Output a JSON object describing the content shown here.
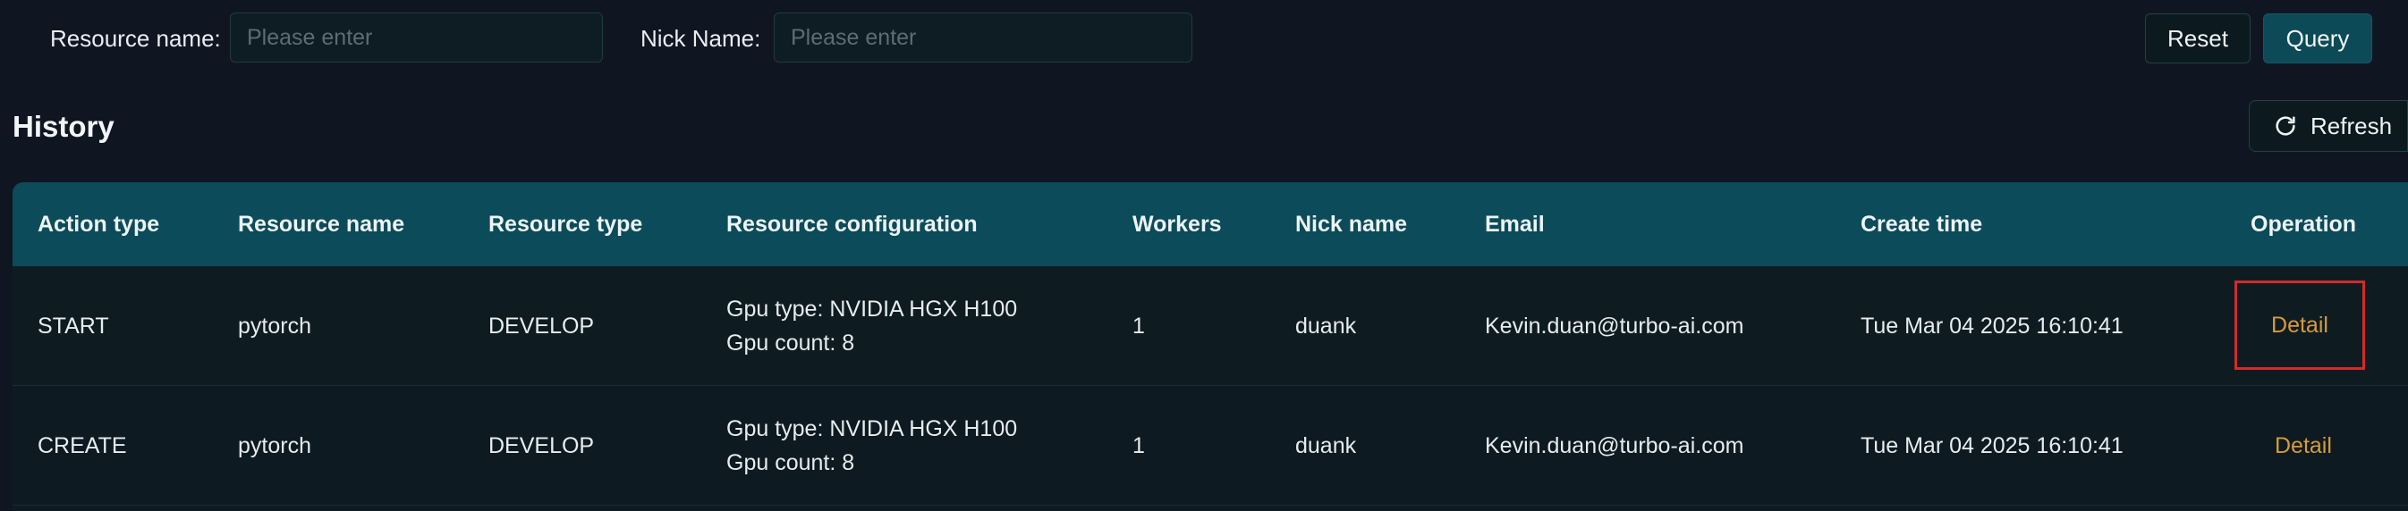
{
  "filters": {
    "resource_name_label": "Resource name:",
    "resource_name_placeholder": "Please enter",
    "nick_name_label": "Nick Name:",
    "nick_name_placeholder": "Please enter",
    "reset_label": "Reset",
    "query_label": "Query"
  },
  "history": {
    "title": "History",
    "refresh_label": "Refresh"
  },
  "table": {
    "columns": [
      "Action type",
      "Resource name",
      "Resource type",
      "Resource configuration",
      "Workers",
      "Nick name",
      "Email",
      "Create time",
      "Operation"
    ],
    "rows": [
      {
        "action_type": "START",
        "resource_name": "pytorch",
        "resource_type": "DEVELOP",
        "config_gpu_type": "Gpu type: NVIDIA HGX H100",
        "config_gpu_count": "Gpu count: 8",
        "workers": "1",
        "nick_name": "duank",
        "email": "Kevin.duan@turbo-ai.com",
        "create_time": "Tue Mar 04 2025 16:10:41",
        "operation": "Detail"
      },
      {
        "action_type": "CREATE",
        "resource_name": "pytorch",
        "resource_type": "DEVELOP",
        "config_gpu_type": "Gpu type: NVIDIA HGX H100",
        "config_gpu_count": "Gpu count: 8",
        "workers": "1",
        "nick_name": "duank",
        "email": "Kevin.duan@turbo-ai.com",
        "create_time": "Tue Mar 04 2025 16:10:41",
        "operation": "Detail"
      }
    ]
  },
  "colors": {
    "background": "#0f1622",
    "header_teal": "#0b4b5a",
    "query_button": "#0d4a57",
    "detail_link": "#d89a3a",
    "highlight_border": "#d32a2a"
  },
  "icons": {
    "refresh": "refresh-icon"
  }
}
